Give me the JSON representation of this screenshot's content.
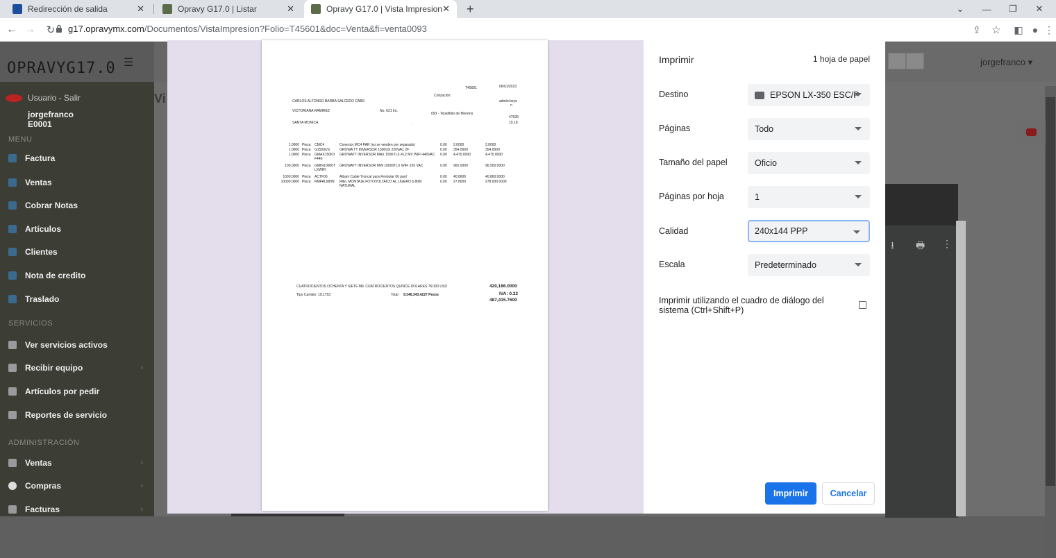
{
  "browser": {
    "tabs": [
      {
        "title": "Redirección de salida"
      },
      {
        "title": "Opravy G17.0 | Listar"
      },
      {
        "title": "Opravy G17.0 | Vista Impresion"
      }
    ],
    "new_tab": "+",
    "url_host": "g17.opravymx.com",
    "url_path": "/Documentos/VistaImpresion?Folio=T45601&doc=Venta&fi=venta0093"
  },
  "app": {
    "logo": "OPRAVYG17.0",
    "user": {
      "salir": "Usuario - Salir",
      "name": "jorgefranco",
      "code": "E0001"
    },
    "page_title_fragment": "Vi",
    "top_user": "jorgefranco",
    "sections": {
      "menu": "MENU",
      "servicios": "SERVICIOS",
      "administracion": "ADMINISTRACIÓN"
    },
    "menu_items": [
      {
        "label": "Factura"
      },
      {
        "label": "Ventas"
      },
      {
        "label": "Cobrar Notas"
      },
      {
        "label": "Artículos"
      },
      {
        "label": "Clientes"
      },
      {
        "label": "Nota de credito"
      },
      {
        "label": "Traslado"
      }
    ],
    "servicios_items": [
      {
        "label": "Ver servicios activos"
      },
      {
        "label": "Recibir equipo"
      },
      {
        "label": "Artículos por pedir"
      },
      {
        "label": "Reportes de servicio"
      }
    ],
    "admin_items": [
      {
        "label": "Ventas"
      },
      {
        "label": "Compras"
      },
      {
        "label": "Facturas"
      }
    ]
  },
  "document": {
    "folio": "T45601",
    "date": "06/01/2023",
    "cotizacion_label": "Cotización:",
    "customer": "CARLOS ALFONSO BARBA SALCEDO CABS",
    "admin": "admin.beye",
    "admin_tail": "n",
    "street": "VICTORIANA RAMIREZ",
    "number": "No. 621 Int.",
    "city": "093 - Tepatitlán de Morelos",
    "zip": "47639",
    "neighborhood": "SANTA MONICA",
    "dot": ".",
    "rate_top": "19.18",
    "items": [
      {
        "qty": "1.0000",
        "unit": "Pieza",
        "code": "CMC4",
        "desc": "Conector MC4 PAR (no se venden por separado)",
        "disc": "0.00",
        "price": "2.0000",
        "total": "2.0000"
      },
      {
        "qty": "1.0000",
        "unit": "Pieza",
        "code": "G1500US",
        "desc": "GROWA TT INVERSOR 1500US 220VAC 2F",
        "disc": "0.00",
        "price": "354.0000",
        "total": "354.0000"
      },
      {
        "qty": "1.0000",
        "unit": "Pieza",
        "code": "GMAX150K3 F440",
        "desc": "GROWATT INVERSOR MAX 150KTL3-XL2 MV WIFI 440VAC",
        "disc": "0.00",
        "price": "4,470.0000",
        "total": "4,470.0000"
      },
      {
        "qty": "100.0000",
        "unit": "Pieza",
        "code": "GMIN10000T LXWIFI",
        "desc": "GROWATT INVERSOR MIN 10000TLX WIFI 220 VAC",
        "disc": "0.00",
        "price": "965.0000",
        "total": "96,500.0000"
      },
      {
        "qty": "1000.0000",
        "unit": "Pieza",
        "code": "ACTF06",
        "desc": "Albam Cable Troncal para Firebolar 06 panl",
        "disc": "0.00",
        "price": "40.8600",
        "total": "40,860.0000"
      },
      {
        "qty": "10000.0000",
        "unit": "Pieza",
        "code": "RMFAL680N",
        "desc": "RIEL MONTAJE FOTOVOLTAICO AL LIGERO 6.80M NATURAL",
        "disc": "0.00",
        "price": "27.8000",
        "total": "278,000.0000"
      }
    ],
    "amount_words": "CUATROCIENTOS OCHENTA Y SIETE MIL CUATROCIENTOS QUINCE DOLARES 76/100 USD",
    "subtotal": "420,186.0000",
    "tipo_cambio": "Tipo Cambio: 19.1753",
    "total_label": "Total:",
    "total_pesos": "9,346,343.4227 Pesos",
    "iva": "IVA: 0.32",
    "grand_total": "487,415.7600"
  },
  "print_dialog": {
    "title": "Imprimir",
    "sheets": "1 hoja de papel",
    "rows": [
      {
        "label": "Destino",
        "value": "EPSON LX-350 ESC/P"
      },
      {
        "label": "Páginas",
        "value": "Todo"
      },
      {
        "label": "Tamaño del papel",
        "value": "Oficio"
      },
      {
        "label": "Páginas por hoja",
        "value": "1"
      },
      {
        "label": "Calidad",
        "value": "240x144 PPP"
      },
      {
        "label": "Escala",
        "value": "Predeterminado"
      }
    ],
    "system_dialog": "Imprimir utilizando el cuadro de diálogo del sistema (Ctrl+Shift+P)",
    "print_button": "Imprimir",
    "cancel_button": "Cancelar"
  }
}
